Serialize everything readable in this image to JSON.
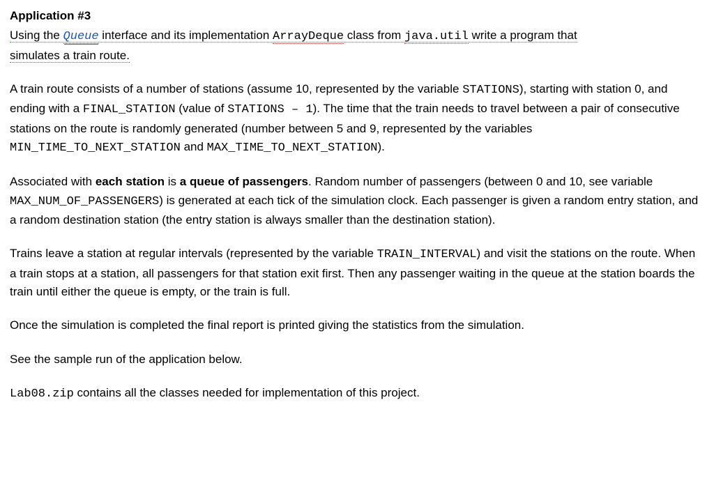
{
  "title": "Application #3",
  "intro": {
    "part1": "Using the ",
    "queue": "Queue",
    "part2": " interface and its implementation ",
    "arraydeque": "ArrayDeque",
    "part3": " class from ",
    "javautil": "java.util",
    "part4": " write a program that",
    "line2": "simulates a train route."
  },
  "p1": {
    "a": "A train route consists of a number of stations (assume 10, represented by the variable ",
    "stations": "STATIONS",
    "b": "), starting with station 0, and ending with a ",
    "final_station": "FINAL_STATION",
    "c": " (value of ",
    "stations2": "STATIONS – 1",
    "d": "). The time that the train needs to travel between a pair of consecutive stations on the route is randomly generated (number between 5 and 9, represented by the variables ",
    "mintime": "MIN_TIME_TO_NEXT_STATION",
    "e": "  and ",
    "maxtime": "MAX_TIME_TO_NEXT_STATION",
    "f": ")."
  },
  "p2": {
    "a": "Associated with ",
    "bold1": "each station",
    "b": " is ",
    "bold2": "a queue of passengers",
    "c": ". Random number of passengers (between 0 and 10, see variable ",
    "maxpass": "MAX_NUM_OF_PASSENGERS",
    "d": ") is generated at each tick of the simulation clock. Each passenger is given a random entry station, and a random destination station (the entry station is always smaller than the destination station)."
  },
  "p3": {
    "a": "Trains leave a station at regular intervals (represented by the variable ",
    "interval": "TRAIN_INTERVAL",
    "b": ") and visit the stations on the route. When a train stops at a station, all passengers for that station exit first. Then any passenger waiting in the queue at the station boards the train until either the queue is empty, or the train is full."
  },
  "p4": "Once the simulation is completed the final report is printed giving the statistics from the simulation.",
  "p5": "See the sample run of the application below.",
  "p6": {
    "zip": "Lab08.zip",
    "a": " contains all the classes needed for implementation of this project."
  }
}
